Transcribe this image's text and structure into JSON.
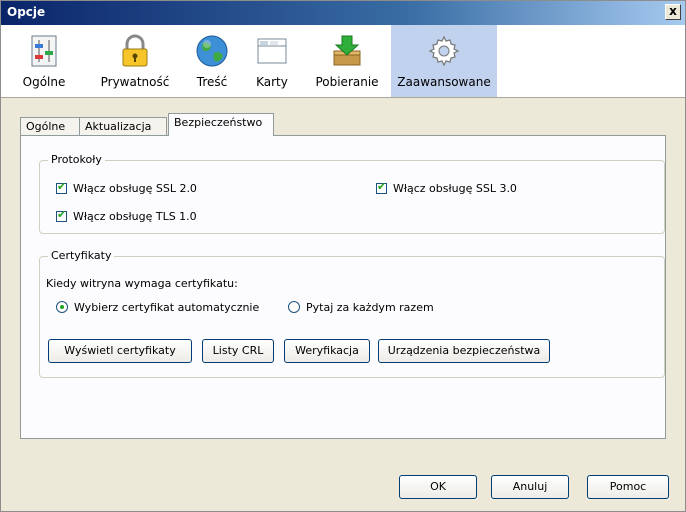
{
  "window": {
    "title": "Opcje",
    "close_label": "x"
  },
  "toolbar": {
    "panes": [
      {
        "label": "Ogólne",
        "icon": "general-icon"
      },
      {
        "label": "Prywatność",
        "icon": "lock-icon"
      },
      {
        "label": "Treść",
        "icon": "globe-icon"
      },
      {
        "label": "Karty",
        "icon": "tabs-icon"
      },
      {
        "label": "Pobieranie",
        "icon": "download-icon"
      },
      {
        "label": "Zaawansowane",
        "icon": "gear-icon",
        "selected": true
      }
    ]
  },
  "tabs": [
    {
      "label": "Ogólne"
    },
    {
      "label": "Aktualizacja"
    },
    {
      "label": "Bezpieczeństwo",
      "active": true
    }
  ],
  "protocols": {
    "legend": "Protokoły",
    "ssl2": {
      "label": "Włącz obsługę SSL 2.0",
      "checked": true
    },
    "ssl3": {
      "label": "Włącz obsługę SSL 3.0",
      "checked": true
    },
    "tls1": {
      "label": "Włącz obsługę TLS 1.0",
      "checked": true
    }
  },
  "certificates": {
    "legend": "Certyfikaty",
    "prompt": "Kiedy witryna wymaga certyfikatu:",
    "auto": {
      "label": "Wybierz certyfikat automatycznie",
      "selected": true
    },
    "ask": {
      "label": "Pytaj za każdym razem",
      "selected": false
    },
    "buttons": {
      "view": "Wyświetl certyfikaty",
      "crl": "Listy CRL",
      "verify": "Weryfikacja",
      "devices": "Urządzenia bezpieczeństwa"
    }
  },
  "footer": {
    "ok": "OK",
    "cancel": "Anuluj",
    "help": "Pomoc"
  },
  "colors": {
    "selected_pane": "#c1d2ee",
    "check": "#21a121",
    "titlebar": "#0a246a"
  }
}
